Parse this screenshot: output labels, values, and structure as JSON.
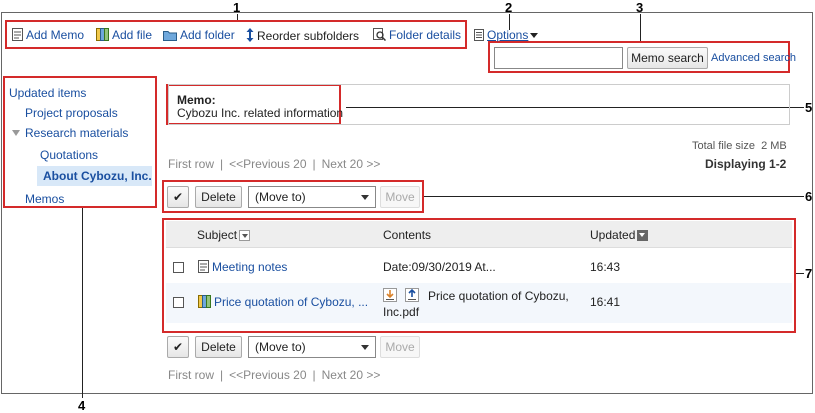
{
  "callouts": [
    "1",
    "2",
    "3",
    "4",
    "5",
    "6",
    "7"
  ],
  "toolbar": {
    "add_memo": "Add Memo",
    "add_file": "Add file",
    "add_folder": "Add folder",
    "reorder": "Reorder subfolders",
    "folder_details": "Folder details",
    "options": "Options"
  },
  "search": {
    "value": "",
    "memo_search_button": "Memo search",
    "advanced_search": "Advanced search"
  },
  "sidebar": {
    "items": [
      {
        "label": "Updated items"
      },
      {
        "label": "Project proposals"
      },
      {
        "label": "Research materials"
      },
      {
        "label": "Quotations"
      },
      {
        "label": "About Cybozu, Inc."
      },
      {
        "label": "Memos"
      }
    ]
  },
  "memo": {
    "heading": "Memo:",
    "text": "Cybozu Inc. related information"
  },
  "file_size": "Total file size  2 MB",
  "pager": {
    "first": "First row",
    "sep": "|",
    "prev": "<<Previous 20",
    "next": "Next 20 >>",
    "displaying": "Displaying 1-2"
  },
  "actions": {
    "checkmark": "✔",
    "delete": "Delete",
    "move_to": "(Move to)",
    "move": "Move"
  },
  "table": {
    "headers": {
      "subject": "Subject",
      "contents": "Contents",
      "updated": "Updated"
    },
    "rows": [
      {
        "subject": "Meeting notes",
        "contents": "Date:09/30/2019 At...",
        "contents2": "",
        "updated": "16:43"
      },
      {
        "subject": "Price quotation of Cybozu, ...",
        "contents": "Price quotation of Cybozu,",
        "contents2": "Inc.pdf",
        "updated": "16:41"
      }
    ]
  },
  "colors": {
    "link": "#1a4fa0",
    "callout_border": "#d42a2a",
    "selected_bg": "#d8e8f8",
    "header_bg": "#eeeeee"
  }
}
